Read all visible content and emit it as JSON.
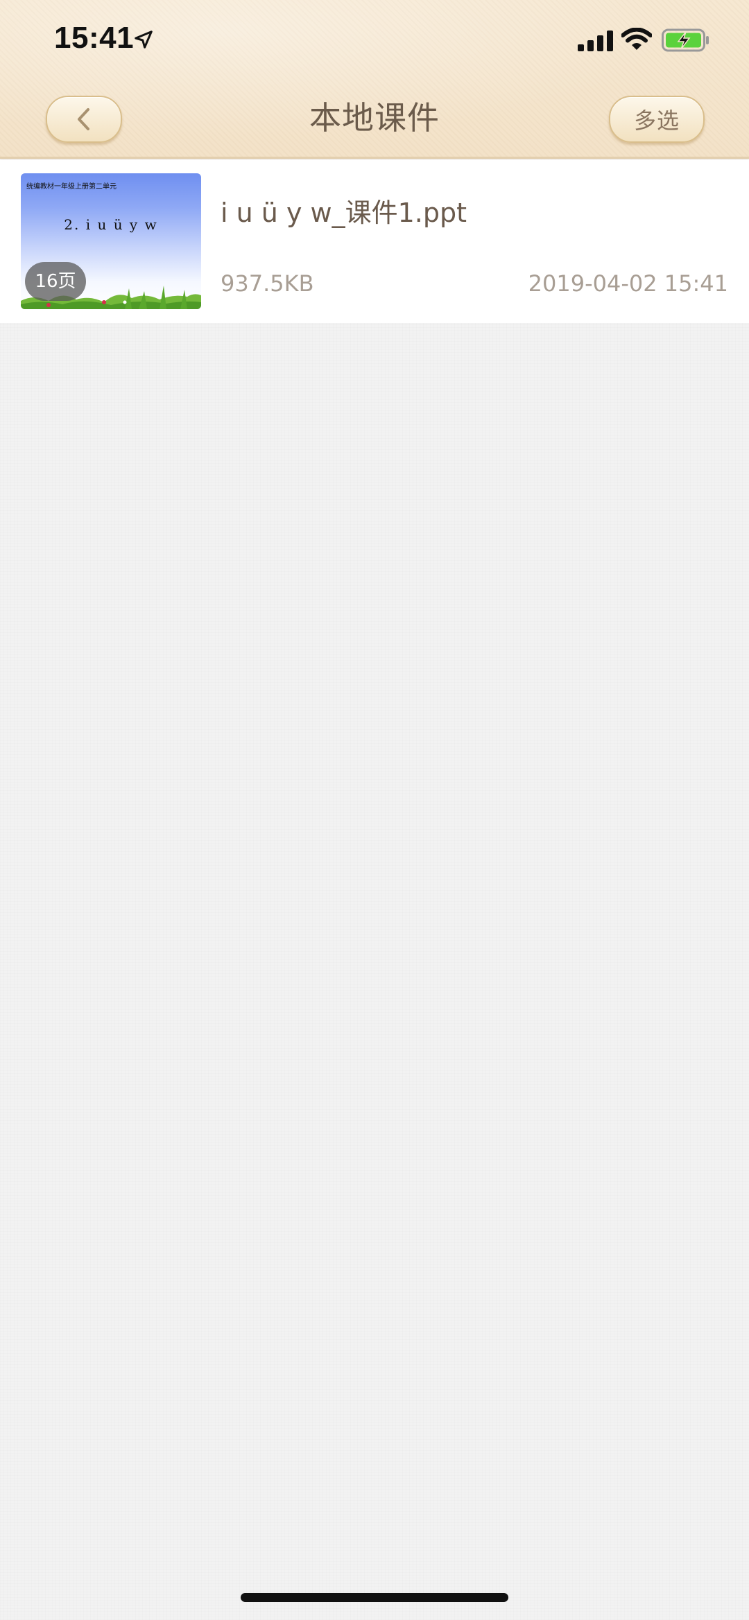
{
  "status_bar": {
    "time": "15:41",
    "icons": [
      "location-arrow-icon",
      "cellular-signal-icon",
      "wifi-icon",
      "battery-charging-icon"
    ]
  },
  "nav": {
    "title": "本地课件",
    "back_icon": "chevron-left-icon",
    "multi_select_label": "多选"
  },
  "files": [
    {
      "name": "i u ü y w_课件1.ppt",
      "size": "937.5KB",
      "date": "2019-04-02 15:41",
      "pages": "16页",
      "thumbnail": {
        "header_text": "统编教材一年级上册第二单元",
        "title_text": "2. i u ü y w"
      }
    }
  ],
  "colors": {
    "header_bg": "#f4e4cb",
    "title_text": "#6b5b4b",
    "meta_text": "#a89e94",
    "battery_green": "#5ad23c"
  }
}
